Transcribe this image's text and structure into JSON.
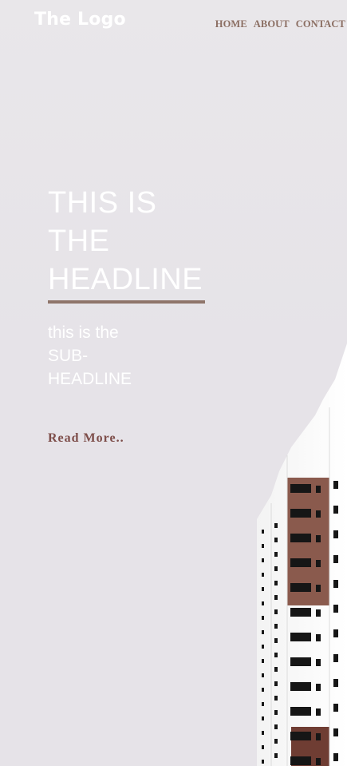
{
  "logo": {
    "text": "The Logo"
  },
  "nav": {
    "items": [
      {
        "label": "HOME"
      },
      {
        "label": "ABOUT"
      },
      {
        "label": "CONTACT"
      }
    ]
  },
  "hero": {
    "headline_line1": "THIS IS",
    "headline_line2": "THE",
    "headline_line3": "HEADLINE",
    "subheadline_line1": "this is the",
    "subheadline_line2": "SUB-",
    "subheadline_line3": "HEADLINE",
    "cta_label": "Read More.."
  },
  "colors": {
    "background": "#e6e3e8",
    "accent": "#8f756a",
    "nav_text": "#8b6e62",
    "cta_text": "#7d4d49",
    "building_brick": "#8a5a4d",
    "text_light": "#ffffff"
  }
}
